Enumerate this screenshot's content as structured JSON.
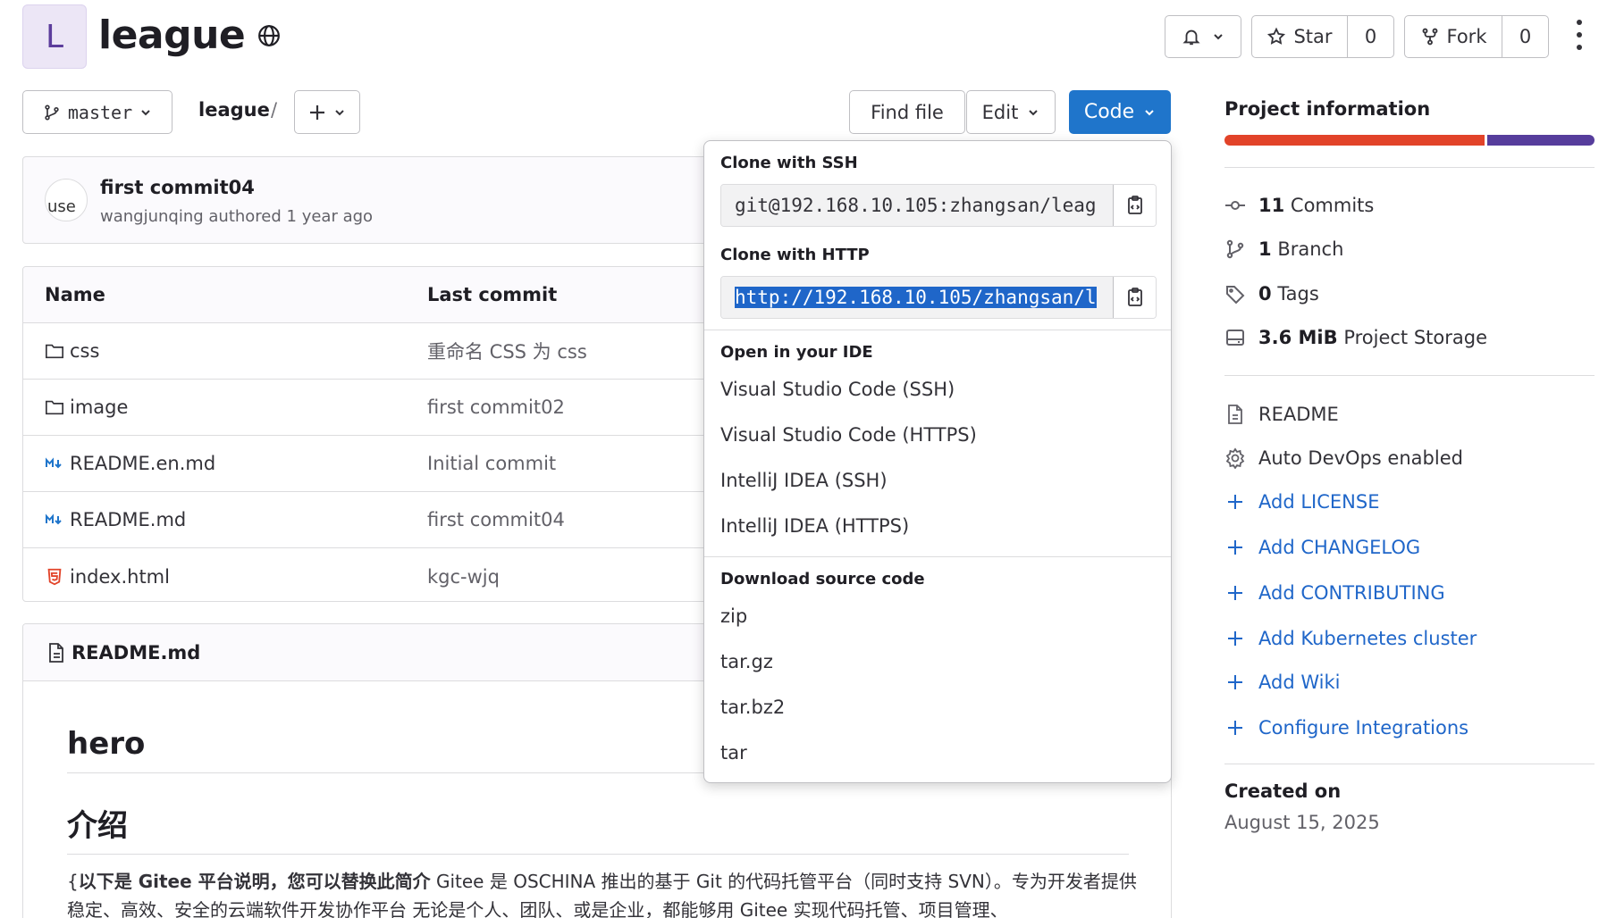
{
  "header": {
    "avatar_letter": "L",
    "project_name": "league",
    "star_label": "Star",
    "star_count": "0",
    "fork_label": "Fork",
    "fork_count": "0"
  },
  "toolbar": {
    "branch": "master",
    "path_root": "league",
    "path_sep": "/",
    "find_file": "Find file",
    "edit": "Edit",
    "code": "Code"
  },
  "commit": {
    "avatar_alt": "use",
    "title": "first commit04",
    "meta": "wangjunqing authored 1 year ago"
  },
  "table": {
    "col_name": "Name",
    "col_last_commit": "Last commit",
    "rows": [
      {
        "name": "css",
        "commit": "重命名 CSS 为 css",
        "type": "folder"
      },
      {
        "name": "image",
        "commit": "first commit02",
        "type": "folder"
      },
      {
        "name": "README.en.md",
        "commit": "Initial commit",
        "type": "markdown"
      },
      {
        "name": "README.md",
        "commit": "first commit04",
        "type": "markdown"
      },
      {
        "name": "index.html",
        "commit": "kgc-wjq",
        "type": "html"
      }
    ]
  },
  "readme": {
    "file": "README.md",
    "h1": "hero",
    "h2": "介绍",
    "p_prefix": "{",
    "p_bold": "以下是 Gitee 平台说明，您可以替换此简介",
    "p_rest": " Gitee 是 OSCHINA 推出的基于 Git 的代码托管平台（同时支持 SVN）。专为开发者提供稳定、高效、安全的云端软件开发协作平台 无论是个人、团队、或是企业，都能够用 Gitee 实现代码托管、项目管理、"
  },
  "clone": {
    "ssh_label": "Clone with SSH",
    "ssh_url": "git@192.168.10.105:zhangsan/leag",
    "http_label": "Clone with HTTP",
    "http_url": "http://192.168.10.105/zhangsan/l",
    "ide_label": "Open in your IDE",
    "ide_items": [
      "Visual Studio Code (SSH)",
      "Visual Studio Code (HTTPS)",
      "IntelliJ IDEA (SSH)",
      "IntelliJ IDEA (HTTPS)"
    ],
    "download_label": "Download source code",
    "download_items": [
      "zip",
      "tar.gz",
      "tar.bz2",
      "tar"
    ]
  },
  "sidebar": {
    "title": "Project information",
    "commits_n": "11",
    "commits_label": "Commits",
    "branch_n": "1",
    "branch_label": "Branch",
    "tags_n": "0",
    "tags_label": "Tags",
    "storage_n": "3.6 MiB",
    "storage_label": "Project Storage",
    "readme": "README",
    "devops": "Auto DevOps enabled",
    "links": [
      "Add LICENSE",
      "Add CHANGELOG",
      "Add CONTRIBUTING",
      "Add Kubernetes cluster",
      "Add Wiki",
      "Configure Integrations"
    ],
    "created_label": "Created on",
    "created_date": "August 15, 2025"
  },
  "colors": {
    "primary": "#1f75cb",
    "link": "#1f66c9",
    "lang_html": "#e24329",
    "lang_css": "#563d9c"
  }
}
